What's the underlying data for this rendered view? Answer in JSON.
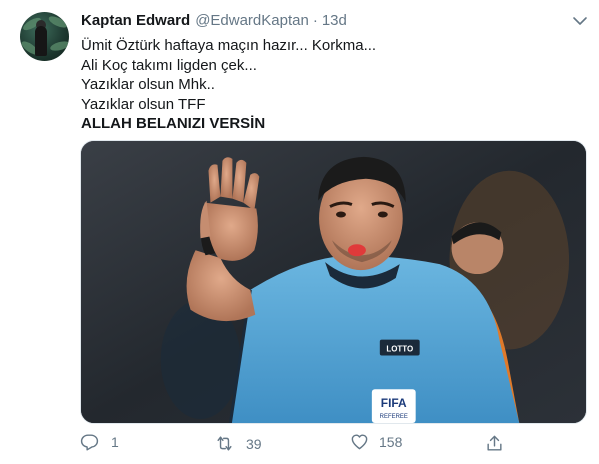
{
  "tweet": {
    "author_name": "Kaptan Edward",
    "handle": "@EdwardKaptan",
    "separator": "·",
    "time": "13d",
    "lines": [
      "Ümit Öztürk haftaya maçın hazır... Korkma...",
      "Ali Koç takımı ligden çek...",
      "Yazıklar olsun Mhk..",
      "Yazıklar olsun TFF"
    ],
    "bold_line": "ALLAH BELANIZI VERSİN",
    "media": {
      "badge_fifa": "FIFA",
      "badge_referee": "REFEREE",
      "badge_lotto": "LOTTO"
    },
    "actions": {
      "reply_count": "1",
      "retweet_count": "39",
      "like_count": "158"
    }
  },
  "colors": {
    "text": "#14171a",
    "muted": "#657786",
    "jersey": "#5aa8d6",
    "background": "#ffffff"
  },
  "icons": [
    "chevron-down-icon",
    "reply-icon",
    "retweet-icon",
    "like-icon",
    "share-icon"
  ]
}
